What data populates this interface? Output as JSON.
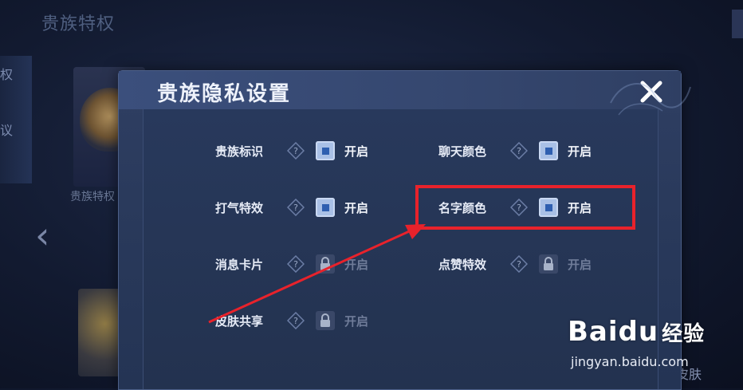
{
  "background": {
    "page_title": "贵族特权",
    "left_tab_1": "权",
    "left_tab_2": "议",
    "card_label": "贵族特权",
    "bottom_right_text": "皮肤"
  },
  "dialog": {
    "title": "贵族隐私设置",
    "close_label": "✕",
    "settings": [
      {
        "label": "贵族标识",
        "state": "开启",
        "locked": false
      },
      {
        "label": "聊天颜色",
        "state": "开启",
        "locked": false
      },
      {
        "label": "打气特效",
        "state": "开启",
        "locked": false
      },
      {
        "label": "名字颜色",
        "state": "开启",
        "locked": false
      },
      {
        "label": "消息卡片",
        "state": "开启",
        "locked": true
      },
      {
        "label": "点赞特效",
        "state": "开启",
        "locked": true
      },
      {
        "label": "皮肤共享",
        "state": "开启",
        "locked": true
      }
    ]
  },
  "watermark": {
    "logo_bai": "Bai",
    "logo_du": "du",
    "logo_suffix": "经验",
    "url": "jingyan.baidu.com"
  },
  "colors": {
    "highlight": "#e8222b",
    "toggle_on": "#a9c0e6",
    "toggle_inner": "#2f5fb0",
    "locked_text": "#6f7c99"
  }
}
